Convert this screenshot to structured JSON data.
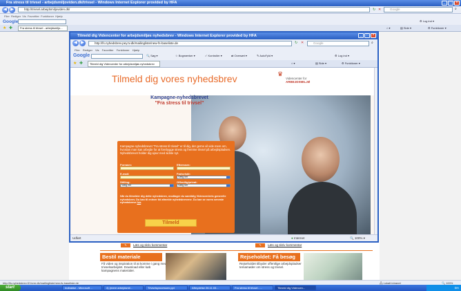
{
  "outer": {
    "title": "Fra stress til trivsel - arbejdsmiljoviden.dk/trivsel - Windows Internet Explorer provided by HFA",
    "address": "http://trivsel.arbejdsmiljoviden.dk/",
    "search_placeholder": "Google",
    "menu": [
      "Filer",
      "Rediger",
      "Vis",
      "Favoritter",
      "Funktioner",
      "Hjælp"
    ],
    "google_label": "Google",
    "tab_label": "Fra stress til trivsel - arbejdsmiljo...",
    "login_label": "Log ind",
    "side_label": "Side",
    "funktioner_label": "Funktioner",
    "status_url": "http://fs.nyhedsbrev.f2.form.dk/mailingliste/new-fs-baseliste.de",
    "status_zone": "Lokalt intranet",
    "status_zoom": "100%",
    "bg_links": [
      "Læs og skriv kommentar",
      "Læs og skriv kommentar"
    ],
    "promo_left": {
      "title": "Bestil materiale",
      "text": "Få viden og inspiration til at komme i gang med trivselsarbejdet. Download eller køb kampagnens materialer."
    },
    "promo_right": {
      "title": "Rejseholdet: Få besøg",
      "text": "Rejseholdet tilbyder offentlige arbejdspladser temamøder om stress og trivsel."
    }
  },
  "taskbar": {
    "start": "start",
    "tasks": [
      "Indbakke - Microsoft ...",
      "4) (mere arbejdsmil...",
      "Trivselsprocessen.ppt",
      "Afbrydelse 26.11.03...",
      "Fra stress til trivsel - ...",
      "Tilmeld dig Videncen..."
    ],
    "clock": "DA"
  },
  "popup": {
    "title": "Tilmeld dig Videncenter for arbejdsmiljøs nyhedsbrev - Windows Internet Explorer provided by HFA",
    "address": "http://fs.nyhedsbrev.pey.tv.dk/mailingliste/new-fs-baseliste.de",
    "search_placeholder": "Google",
    "menu": [
      "Filer",
      "Rediger",
      "Vis",
      "Favoritter",
      "Funktioner",
      "Hjælp"
    ],
    "google_label": "Google",
    "toolbar_items": [
      "Søg",
      "Bogmærker",
      "Kontroller",
      "Oversæt",
      "AutoFyld"
    ],
    "login_label": "Log ind",
    "tab_label": "Tilmeld dig Videncenter for arbejdsmiljøs nyhedsbrev",
    "side_label": "Side",
    "funktioner_label": "Funktioner",
    "status_left": "Udført",
    "status_zone": "Internet",
    "status_zoom": "100%"
  },
  "page": {
    "hero_title": "Tilmeld dig vores nyhedsbrev",
    "logo_line1": "Videncenter for",
    "logo_line2": "ARBEJDSMILJØ",
    "campaign_head": "Kampagne-nyhedsbrevet",
    "campaign_sub": "\"Fra stress til trivsel\"",
    "intro": "Kampagne-nyhedsbrevet \"Fra stress til trivsel\" er til dig, der gerne vil vide mere om, hvordan man kan arbejde for at forebygge stress og fremme trivsel på arbejdspladsen. Nyhedsbrevet holder dig ajour med sidste nyt.",
    "fields": {
      "fornavn": "Fornavn:",
      "efternavn": "Efternavn:",
      "email": "E-mail:",
      "fodselsaar": "Fødselsår:",
      "fodselsaar_value": "Vælg her",
      "stilling": "Stilling:",
      "stilling_value": "Vælg her",
      "offentlig": "Offentlig/privat:",
      "offentlig_value": "Vælg her"
    },
    "notice": "Når du tilmelder dig dette nyhedsbrev, modtager du samtidig Videncentrets generelle nyhedsbrev. Du kan til enhver tid afmelde nyhedsbrevene. Du kan se vores seneste nyhedsbreve",
    "notice_link": "her",
    "submit": "Tilmeld"
  }
}
